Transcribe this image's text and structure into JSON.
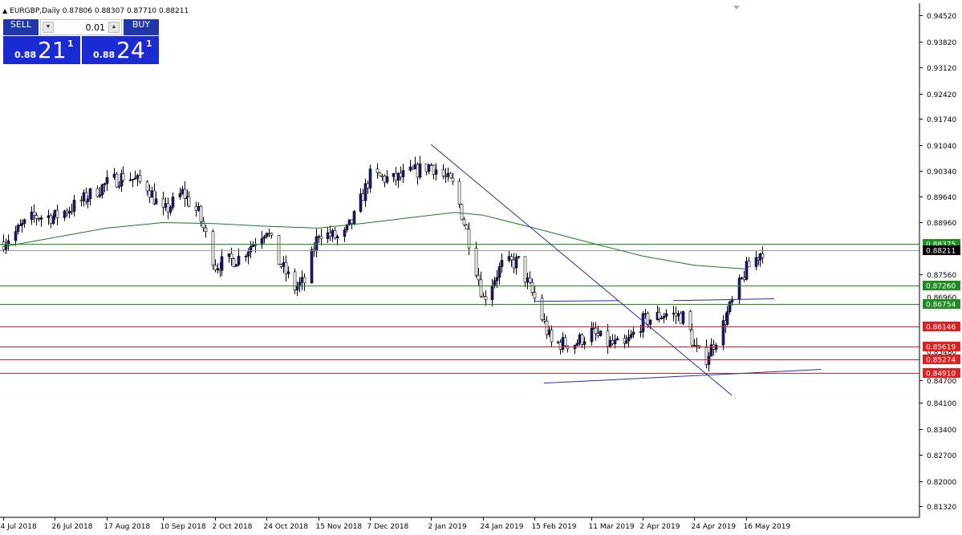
{
  "header": {
    "symbol_info": "EURGBP,Daily",
    "ohlc": "0.87806 0.88307 0.87710 0.88211"
  },
  "trade_panel": {
    "sell_label": "SELL",
    "buy_label": "BUY",
    "lot_size": "0.01",
    "sell_prefix": "0.88",
    "sell_big": "21",
    "sell_sup": "1",
    "buy_prefix": "0.88",
    "buy_big": "24",
    "buy_sup": "1"
  },
  "colors": {
    "bull_candle": "#1b1a7a",
    "moving_average": "#1a7a1a",
    "support_line": "#1e8c1e",
    "resistance_line": "#e02020",
    "trendline": "#2a2aa8",
    "panel_blue": "#1a2bd3"
  },
  "chart_data": {
    "type": "candlestick",
    "symbol": "EURGBP",
    "timeframe": "Daily",
    "ylim": [
      0.8102,
      0.9485
    ],
    "y_ticks": [
      "0.94520",
      "0.93820",
      "0.93120",
      "0.92420",
      "0.91740",
      "0.91040",
      "0.90340",
      "0.89640",
      "0.88960",
      "0.87560",
      "0.84700",
      "0.84100",
      "0.83400",
      "0.82700",
      "0.82000",
      "0.81320"
    ],
    "x_ticks": [
      "4 Jul 2018",
      "26 Jul 2018",
      "17 Aug 2018",
      "10 Sep 2018",
      "2 Oct 2018",
      "24 Oct 2018",
      "15 Nov 2018",
      "7 Dec 2018",
      "2 Jan 2019",
      "24 Jan 2019",
      "15 Feb 2019",
      "11 Mar 2019",
      "2 Apr 2019",
      "24 Apr 2019",
      "16 May 2019"
    ],
    "current_price": {
      "label": "0.88211",
      "value": 0.88211
    },
    "horizontal_levels": [
      {
        "label": "0.88375",
        "value": 0.88375,
        "color": "green"
      },
      {
        "label": "0.87260",
        "value": 0.8726,
        "color": "green"
      },
      {
        "label": "0.86754",
        "value": 0.86754,
        "color": "green"
      },
      {
        "label": "0.86146",
        "value": 0.86146,
        "color": "red"
      },
      {
        "label": "0.85619",
        "value": 0.85619,
        "color": "red"
      },
      {
        "label": "0.85274",
        "value": 0.85274,
        "color": "red"
      },
      {
        "label": "0.84910",
        "value": 0.8491,
        "color": "red"
      }
    ],
    "obscured_ticks": [
      "0.86960",
      "0.85480"
    ],
    "series": [
      {
        "type": "close_path",
        "points": [
          [
            "4 Jul 2018",
            0.8843
          ],
          [
            "17 Jul 2018",
            0.8911
          ],
          [
            "26 Jul 2018",
            0.8911
          ],
          [
            "3 Aug 2018",
            0.894
          ],
          [
            "17 Aug 2018",
            0.9
          ],
          [
            "25 Aug 2018",
            0.9022
          ],
          [
            "3 Sep 2018",
            0.8992
          ],
          [
            "10 Sep 2018",
            0.892
          ],
          [
            "18 Sep 2018",
            0.8975
          ],
          [
            "25 Sep 2018",
            0.892
          ],
          [
            "2 Oct 2018",
            0.878
          ],
          [
            "12 Oct 2018",
            0.88
          ],
          [
            "24 Oct 2018",
            0.888
          ],
          [
            "28 Oct 2018",
            0.88
          ],
          [
            "5 Nov 2018",
            0.872
          ],
          [
            "9 Nov 2018",
            0.8735
          ],
          [
            "15 Nov 2018",
            0.887
          ],
          [
            "25 Nov 2018",
            0.885
          ],
          [
            "1 Dec 2018",
            0.892
          ],
          [
            "7 Dec 2018",
            0.902
          ],
          [
            "17 Dec 2018",
            0.901
          ],
          [
            "2 Jan 2019",
            0.905
          ],
          [
            "12 Jan 2019",
            0.899
          ],
          [
            "20 Jan 2019",
            0.88
          ],
          [
            "24 Jan 2019",
            0.869
          ],
          [
            "1 Feb 2019",
            0.878
          ],
          [
            "8 Feb 2019",
            0.879
          ],
          [
            "15 Feb 2019",
            0.869
          ],
          [
            "22 Feb 2019",
            0.857
          ],
          [
            "4 Mar 2019",
            0.857
          ],
          [
            "11 Mar 2019",
            0.86
          ],
          [
            "18 Mar 2019",
            0.857
          ],
          [
            "25 Mar 2019",
            0.856
          ],
          [
            "2 Apr 2019",
            0.863
          ],
          [
            "12 Apr 2019",
            0.865
          ],
          [
            "20 Apr 2019",
            0.864
          ],
          [
            "24 Apr 2019",
            0.856
          ],
          [
            "28 Apr 2019",
            0.852
          ],
          [
            "6 May 2019",
            0.862
          ],
          [
            "16 May 2019",
            0.877
          ],
          [
            "23 May 2019",
            0.8821
          ]
        ]
      },
      {
        "type": "moving_average",
        "points": [
          [
            "4 Jul 2018",
            0.883
          ],
          [
            "26 Jul 2018",
            0.8855
          ],
          [
            "17 Aug 2018",
            0.888
          ],
          [
            "10 Sep 2018",
            0.8895
          ],
          [
            "2 Oct 2018",
            0.8892
          ],
          [
            "24 Oct 2018",
            0.8885
          ],
          [
            "15 Nov 2018",
            0.888
          ],
          [
            "7 Dec 2018",
            0.8895
          ],
          [
            "2 Jan 2019",
            0.8915
          ],
          [
            "12 Jan 2019",
            0.8922
          ],
          [
            "24 Jan 2019",
            0.8915
          ],
          [
            "15 Feb 2019",
            0.888
          ],
          [
            "11 Mar 2019",
            0.884
          ],
          [
            "2 Apr 2019",
            0.8805
          ],
          [
            "24 Apr 2019",
            0.878
          ],
          [
            "16 May 2019",
            0.877
          ]
        ]
      },
      {
        "type": "trendline",
        "points": [
          [
            "2 Jan 2019",
            0.9105
          ],
          [
            "10 May 2019",
            0.843
          ]
        ]
      },
      {
        "type": "trendline",
        "points": [
          [
            "19 Feb 2019",
            0.8463
          ],
          [
            "17 Jun 2019",
            0.85
          ]
        ]
      },
      {
        "type": "trendline",
        "points": [
          [
            "15 Feb 2019",
            0.8683
          ],
          [
            "23 Mar 2019",
            0.8685
          ]
        ]
      },
      {
        "type": "trendline",
        "points": [
          [
            "15 Apr 2019",
            0.8685
          ],
          [
            "28 May 2019",
            0.869
          ]
        ]
      }
    ]
  }
}
